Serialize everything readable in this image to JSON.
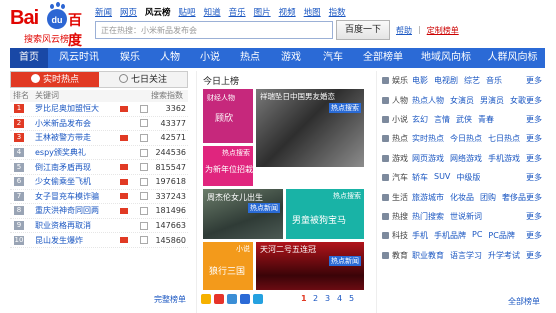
{
  "logo": {
    "bai": "Bai",
    "du": "du",
    "baidu": "百度",
    "sub": "搜索风云榜"
  },
  "topnav": [
    "新闻",
    "网页",
    "风云榜",
    "贴吧",
    "知道",
    "音乐",
    "图片",
    "视频",
    "地图",
    "指数"
  ],
  "topnav_current": "风云榜",
  "search": {
    "placeholder": "正在热搜：小米新品发布会",
    "button": "百度一下"
  },
  "toplinks": {
    "help": "帮助",
    "separator": "|",
    "customize": "定制榜单"
  },
  "categories": [
    "首页",
    "风云时讯",
    "娱乐",
    "人物",
    "小说",
    "热点",
    "游戏",
    "汽车",
    "全部榜单",
    "地域风向标",
    "人群风向标"
  ],
  "left": {
    "tab_realtime": "实时热点",
    "tab_7day": "七日关注",
    "header": {
      "rank": "排名",
      "keyword": "关键词",
      "index": "搜索指数"
    },
    "rows": [
      {
        "rank": "1",
        "keyword": "罗比尼奥加盟恒大",
        "flag": true,
        "value": "3362"
      },
      {
        "rank": "2",
        "keyword": "小米新品发布会",
        "flag": false,
        "value": "43377"
      },
      {
        "rank": "3",
        "keyword": "王林被警方带走",
        "flag": true,
        "value": "42571"
      },
      {
        "rank": "4",
        "keyword": "espy颁奖典礼",
        "flag": false,
        "value": "244536"
      },
      {
        "rank": "5",
        "keyword": "倒江南矛盾再现",
        "flag": true,
        "value": "815547"
      },
      {
        "rank": "6",
        "keyword": "少女偷乘坐飞机",
        "flag": true,
        "value": "197618"
      },
      {
        "rank": "7",
        "keyword": "女子冒充车模诈骗",
        "flag": true,
        "value": "337243"
      },
      {
        "rank": "8",
        "keyword": "重庆洪神奇同回两",
        "flag": true,
        "value": "181496"
      },
      {
        "rank": "9",
        "keyword": "职业资格再取消",
        "flag": false,
        "value": "147663"
      },
      {
        "rank": "10",
        "keyword": "昆山发生爆炸",
        "flag": true,
        "value": "145860"
      }
    ],
    "footer": "完整榜单"
  },
  "mid": {
    "title": "今日上榜",
    "tiles": {
      "t1_tag": "财经人物",
      "t1_name": "顾欣",
      "t2_title": "祥瑞坠日中国男友婚恋",
      "t2_tag": "热点搜索",
      "t3_tag": "热点搜索",
      "t3_name": "为新年位招栽",
      "t4_title": "周杰伦女儿出生",
      "t4_tag": "热点新闻",
      "t5_tag": "热点搜索",
      "t5_name": "男童被狗宝马",
      "t6_tag": "小说",
      "t6_name": "狼行三国",
      "t7_title": "天河二号五连冠",
      "t7_tag": "热点新闻"
    },
    "pages": [
      "1",
      "2",
      "3",
      "4",
      "5"
    ],
    "current_page": "1"
  },
  "right": {
    "rows": [
      {
        "cat": "娱乐",
        "links": [
          "电影",
          "电视剧",
          "综艺",
          "音乐"
        ]
      },
      {
        "cat": "人物",
        "links": [
          "热点人物",
          "女演员",
          "男演员",
          "女歌手"
        ]
      },
      {
        "cat": "小说",
        "links": [
          "玄幻",
          "言情",
          "武侠",
          "青春"
        ]
      },
      {
        "cat": "热点",
        "links": [
          "实时热点",
          "今日热点",
          "七日热点"
        ]
      },
      {
        "cat": "游戏",
        "links": [
          "网页游戏",
          "网络游戏",
          "手机游戏"
        ]
      },
      {
        "cat": "汽车",
        "links": [
          "轿车",
          "SUV",
          "中级版"
        ]
      },
      {
        "cat": "生活",
        "links": [
          "旅游城市",
          "化妆品",
          "团购",
          "奢侈品"
        ]
      },
      {
        "cat": "热搜",
        "links": [
          "热门搜索",
          "世说新词"
        ]
      },
      {
        "cat": "科技",
        "links": [
          "手机",
          "手机品牌",
          "PC",
          "PC品牌"
        ]
      },
      {
        "cat": "教育",
        "links": [
          "职业教育",
          "语言学习",
          "升学考试"
        ]
      }
    ],
    "more": "更多",
    "footer": "全部榜单"
  },
  "colors": {
    "brand_red": "#e10602",
    "nav_blue": "#2b6ad6",
    "tab_red": "#e13a24",
    "link": "#1b57c2"
  }
}
